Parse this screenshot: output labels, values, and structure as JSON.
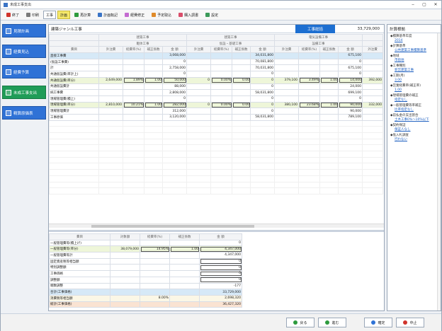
{
  "window": {
    "title": "未成工事支出"
  },
  "toolbar": [
    {
      "label": "終了",
      "icon": "close-icon",
      "color": "#d0342c"
    },
    {
      "label": "印刷",
      "icon": "print-icon",
      "color": "#7a7a7a"
    },
    {
      "label": "工事",
      "icon": "none",
      "color": "",
      "active": true
    },
    {
      "label": "計画",
      "icon": "none",
      "color": "",
      "highlight": true
    },
    {
      "label": "再計算",
      "icon": "refresh-icon",
      "color": "#2e9b3e"
    },
    {
      "label": "計画転記",
      "icon": "transfer-icon",
      "color": "#3a74c6"
    },
    {
      "label": "経費修正",
      "icon": "edit-icon",
      "color": "#c46bd1"
    },
    {
      "label": "予定取込",
      "icon": "import-icon",
      "color": "#e08b2a"
    },
    {
      "label": "購入調書",
      "icon": "document-icon",
      "color": "#d94d6a"
    },
    {
      "label": "設定",
      "icon": "gear-icon",
      "color": "#3b9a5a"
    }
  ],
  "sidebar": [
    {
      "label": "見積計画",
      "selected": false
    },
    {
      "label": "経費見込",
      "selected": false
    },
    {
      "label": "経費予算",
      "selected": false
    },
    {
      "label": "未成工事支出",
      "selected": true
    },
    {
      "label": "精算原価表",
      "selected": false
    }
  ],
  "main": {
    "title": "建築ジャンル工事",
    "summary_tab": "工事総括",
    "total": "33,729,000",
    "group_headers": [
      "建築工事",
      "建築工事",
      "電気設備工事"
    ],
    "sub_headers": [
      "躯体工事",
      "仮設・基礎工事",
      "設備工事"
    ],
    "columns": [
      "費目",
      "外注費",
      "経費率(%)",
      "補正係数",
      "金 額",
      "外注費",
      "経費率(%)",
      "補正係数",
      "金 額",
      "外注費",
      "経費率(%)",
      "補正係数",
      "金 額",
      "外注費"
    ],
    "rows": [
      {
        "style": "blue",
        "cells": [
          "直接工事費",
          "",
          "",
          "",
          "3,068,000",
          "",
          "",
          "",
          "34,031,800",
          "",
          "",
          "",
          "675,100",
          ""
        ]
      },
      {
        "style": "",
        "cells": [
          "(仮設工事費)",
          "",
          "",
          "",
          "0",
          "",
          "",
          "",
          "70,081,800",
          "",
          "",
          "",
          "0",
          ""
        ]
      },
      {
        "style": "",
        "cells": [
          "計",
          "",
          "",
          "",
          "2,758,000",
          "",
          "",
          "",
          "70,031,800",
          "",
          "",
          "",
          "675,100",
          ""
        ]
      },
      {
        "style": "",
        "cells": [
          "共通仮設費(率計上)",
          "",
          "",
          "",
          "0",
          "",
          "",
          "",
          "0",
          "",
          "",
          "",
          "0",
          ""
        ]
      },
      {
        "style": "green",
        "cells": [
          "共通仮設費(率分)",
          "2,649,000",
          "1.89%",
          "1.00",
          "50,000",
          "0",
          "0.00%",
          "0.00",
          "0",
          "379,100",
          "3.49%",
          "1.00",
          "14,000",
          "392,000"
        ]
      },
      {
        "style": "",
        "cells": [
          "共通仮設費計",
          "",
          "",
          "",
          "88,000",
          "",
          "",
          "",
          "0",
          "",
          "",
          "",
          "24,000",
          ""
        ]
      },
      {
        "style": "",
        "cells": [
          "純工事費",
          "",
          "",
          "",
          "2,808,000",
          "",
          "",
          "",
          "58,031,800",
          "",
          "",
          "",
          "699,100",
          ""
        ]
      },
      {
        "style": "",
        "cells": [
          "現場管理費(積上)",
          "",
          "",
          "",
          "0",
          "",
          "",
          "",
          "0",
          "",
          "",
          "",
          "0",
          ""
        ]
      },
      {
        "style": "green",
        "cells": [
          "現場管理費(率分)",
          "2,810,000",
          "10.21%",
          "1.00",
          "282,000",
          "0",
          "0.00%",
          "0.00",
          "0",
          "380,100",
          "23.68%",
          "1.00",
          "90,000",
          "332,000"
        ]
      },
      {
        "style": "",
        "cells": [
          "現場管理費計",
          "",
          "",
          "",
          "312,000",
          "",
          "",
          "",
          "0",
          "",
          "",
          "",
          "90,000",
          ""
        ]
      },
      {
        "style": "",
        "cells": [
          "工事原価",
          "",
          "",
          "",
          "3,120,000",
          "",
          "",
          "",
          "58,031,800",
          "",
          "",
          "",
          "789,100",
          ""
        ]
      }
    ]
  },
  "summary": {
    "columns": [
      "費目",
      "対象額",
      "経費率(%)",
      "補正係数",
      "金 額"
    ],
    "rows": [
      {
        "style": "",
        "cells": [
          "一般管理費等(積上げ)",
          "",
          "",
          "",
          "0"
        ]
      },
      {
        "style": "green",
        "cells": [
          "一般管理費等(率分)",
          "38,079,000",
          "14.95%",
          "1.00",
          "4,347,000"
        ]
      },
      {
        "style": "",
        "cells": [
          "一般管理費等計",
          "",
          "",
          "",
          "4,347,000"
        ]
      },
      {
        "style": "",
        "cells": [
          "固定資産税等相当額",
          "",
          "",
          "",
          "0"
        ]
      },
      {
        "style": "",
        "cells": [
          "特別調整額",
          "",
          "",
          "",
          "0"
        ]
      },
      {
        "style": "",
        "cells": [
          "工事価格",
          "",
          "",
          "",
          "0"
        ]
      },
      {
        "style": "",
        "cells": [
          "調整額",
          "",
          "",
          "",
          "0"
        ]
      },
      {
        "style": "",
        "cells": [
          "端数調整",
          "",
          "",
          "",
          "-177"
        ]
      },
      {
        "style": "blue",
        "cells": [
          "合計(工事価格)",
          "",
          "",
          "",
          "33,729,000"
        ]
      },
      {
        "style": "cream",
        "cells": [
          "消費税等相当額",
          "",
          "8.00%",
          "",
          "2,698,320"
        ]
      },
      {
        "style": "orange",
        "cells": [
          "総計(工事価格)",
          "",
          "",
          "",
          "36,427,320"
        ]
      }
    ]
  },
  "right_panel": {
    "title": "計算根拠",
    "items": [
      {
        "label": "◆積算基準年度",
        "link": "2014"
      },
      {
        "label": "◆計算基準",
        "link": "公共建築工事積算基準"
      },
      {
        "label": "◆地域",
        "link": "市街地"
      },
      {
        "label": "◆工事種別",
        "link": "新営建築工事"
      },
      {
        "label": "◆工期(月)",
        "link": "3.00"
      },
      {
        "label": "◆営業経費率(補正率)",
        "link": "1.00"
      },
      {
        "label": "◆現場管理費の補正",
        "link": "指定なし"
      },
      {
        "label": "◆一般管理費等率補正",
        "link": "比率指定なし"
      },
      {
        "label": "◆前払金の支出割合",
        "link": "土木工事0%〜10%以下"
      },
      {
        "label": "◆契約保証",
        "link": "保証人なし"
      },
      {
        "label": "◆低入札調査",
        "link": "行わない"
      }
    ]
  },
  "footer": {
    "prev": "戻る",
    "next": "進む",
    "ok": "確定",
    "cancel": "中止"
  }
}
